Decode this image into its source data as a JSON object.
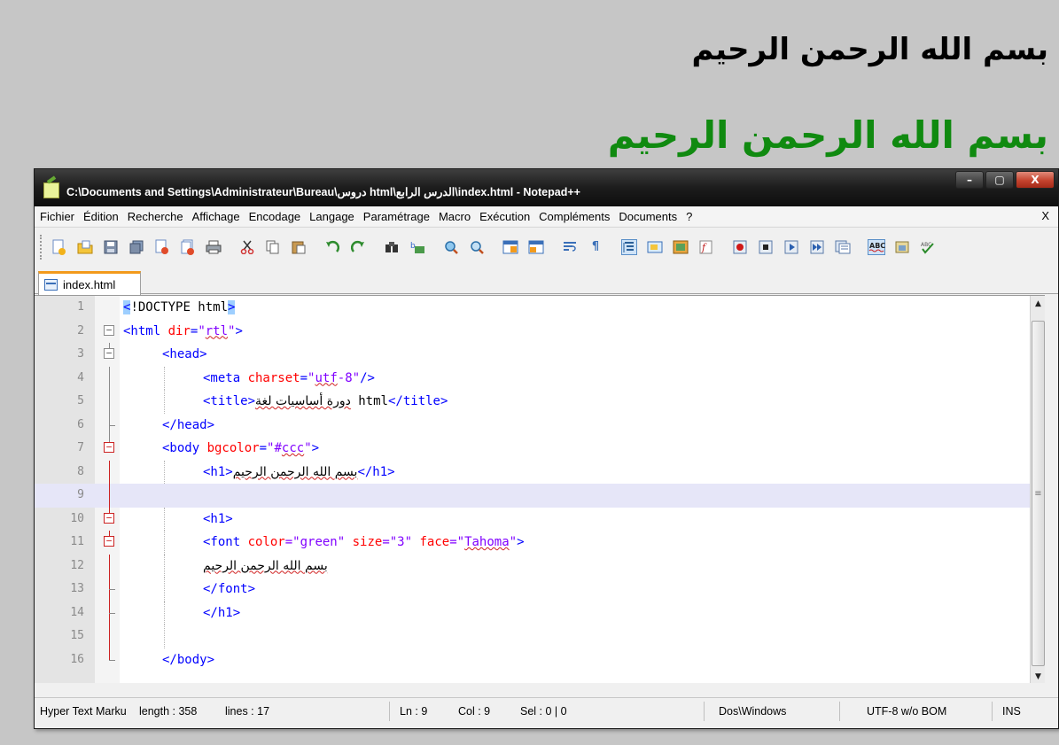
{
  "page": {
    "heading_plain": "بسم الله الرحمن الرحيم",
    "heading_green": "بسم الله الرحمن الرحيم"
  },
  "window": {
    "title": "C:\\Documents and Settings\\Administrateur\\Bureau\\دروس html\\الدرس الرابع\\index.html - Notepad++",
    "minimize": "–",
    "maximize": "▢",
    "close": "X"
  },
  "menu": {
    "items": [
      "Fichier",
      "Édition",
      "Recherche",
      "Affichage",
      "Encodage",
      "Langage",
      "Paramétrage",
      "Macro",
      "Exécution",
      "Compléments",
      "Documents",
      "?"
    ],
    "close": "X"
  },
  "toolbar": {
    "icons": [
      "new-file-icon",
      "open-file-icon",
      "save-icon",
      "save-all-icon",
      "close-icon",
      "close-all-icon",
      "print-icon",
      "cut-icon",
      "copy-icon",
      "paste-icon",
      "undo-icon",
      "redo-icon",
      "find-icon",
      "replace-icon",
      "zoom-in-icon",
      "zoom-out-icon",
      "sync-vertical-icon",
      "sync-horizontal-icon",
      "word-wrap-icon",
      "show-all-chars-icon",
      "indent-guide-icon",
      "user-lang-icon",
      "doc-map-icon",
      "function-list-icon",
      "record-macro-icon",
      "stop-macro-icon",
      "play-macro-icon",
      "run-macro-multiple-icon",
      "save-macro-icon",
      "spellcheck-icon",
      "spell-settings-icon",
      "abc-check-icon"
    ]
  },
  "tab": {
    "label": "index.html"
  },
  "editor": {
    "lines": [
      {
        "n": "1"
      },
      {
        "n": "2"
      },
      {
        "n": "3"
      },
      {
        "n": "4"
      },
      {
        "n": "5"
      },
      {
        "n": "6"
      },
      {
        "n": "7"
      },
      {
        "n": "8"
      },
      {
        "n": "9"
      },
      {
        "n": "10"
      },
      {
        "n": "11"
      },
      {
        "n": "12"
      },
      {
        "n": "13"
      },
      {
        "n": "14"
      },
      {
        "n": "15"
      },
      {
        "n": "16"
      }
    ],
    "code": {
      "l1_open": "<",
      "l1_bang": "!DOCTYPE html",
      "l1_close": ">",
      "l2_tag": "<html ",
      "l2_attr": "dir",
      "l2_eq": "=",
      "l2_val_q1": "\"",
      "l2_val": "rtl",
      "l2_val_q2": "\"",
      "l2_end": ">",
      "l3": "<head>",
      "l4_tag": "<meta ",
      "l4_attr": "charset",
      "l4_eq": "=",
      "l4_q1": "\"",
      "l4_val": "utf",
      "l4_val2": "-8\"",
      "l4_end": "/>",
      "l5_open": "<title>",
      "l5_ar": "دورة أساسيات لغة",
      "l5_txt": " html",
      "l5_close": "</title>",
      "l6": "</head>",
      "l7_tag": "<body ",
      "l7_attr": "bgcolor",
      "l7_eq": "=",
      "l7_q1": "\"#",
      "l7_val": "ccc",
      "l7_q2": "\"",
      "l7_end": ">",
      "l8_open": "<h1>",
      "l8_ar": "بسم الله الرحمن الرحيم",
      "l8_close": "</h1>",
      "l10": "<h1>",
      "l11_tag": "<font ",
      "l11_a1": "color",
      "l11_v1": "=\"green\"",
      "l11_a2": " size",
      "l11_v2": "=\"3\"",
      "l11_a3": " face",
      "l11_v3q": "=\"",
      "l11_v3": "Tahoma",
      "l11_v3e": "\"",
      "l11_end": ">",
      "l12_ar": "بسم الله الرحمن الرحيم",
      "l13": "</font>",
      "l14": "</h1>",
      "l16": "</body>"
    }
  },
  "status": {
    "lang": "Hyper Text Marku",
    "length": "length : 358",
    "lines": "lines : 17",
    "ln": "Ln : 9",
    "col": "Col : 9",
    "sel": "Sel : 0 | 0",
    "eol": "Dos\\Windows",
    "encoding": "UTF-8 w/o BOM",
    "mode": "INS"
  },
  "colors": {
    "heading_green": "#108a10",
    "tag": "#0000ff",
    "attribute": "#ff0000",
    "value": "#8000ff",
    "current_line": "#e6e6f8",
    "tab_accent": "#f29a1c"
  }
}
